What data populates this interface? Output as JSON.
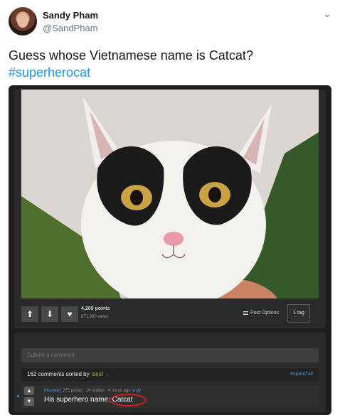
{
  "user": {
    "name": "Sandy Pham",
    "handle": "@SandPham"
  },
  "tweet": {
    "text": "Guess whose Vietnamese name is Catcat?",
    "hashtag": "#superherocat"
  },
  "post": {
    "points": "4,209 points",
    "views": "871,990 views",
    "options_label": "Post Options",
    "tag_label": "1 tag"
  },
  "comments": {
    "input_placeholder": "Submit a comment",
    "count_text": "162 comments sorted by",
    "sort_value": "best",
    "expand_label": "expand all"
  },
  "comment": {
    "user": "Moonkey",
    "points": "275 points",
    "replies": "14 replies",
    "time": "4 hours ago",
    "reply": "reply",
    "text": "His superhero name: Catcat"
  },
  "colors": {
    "hashtag": "#1b95e0",
    "highlight_circle": "#d21e1e",
    "sort_best": "#8fbd3a"
  },
  "icons": [
    "chevron-down-icon",
    "arrow-up-icon",
    "arrow-down-icon",
    "heart-icon",
    "options-icon"
  ]
}
